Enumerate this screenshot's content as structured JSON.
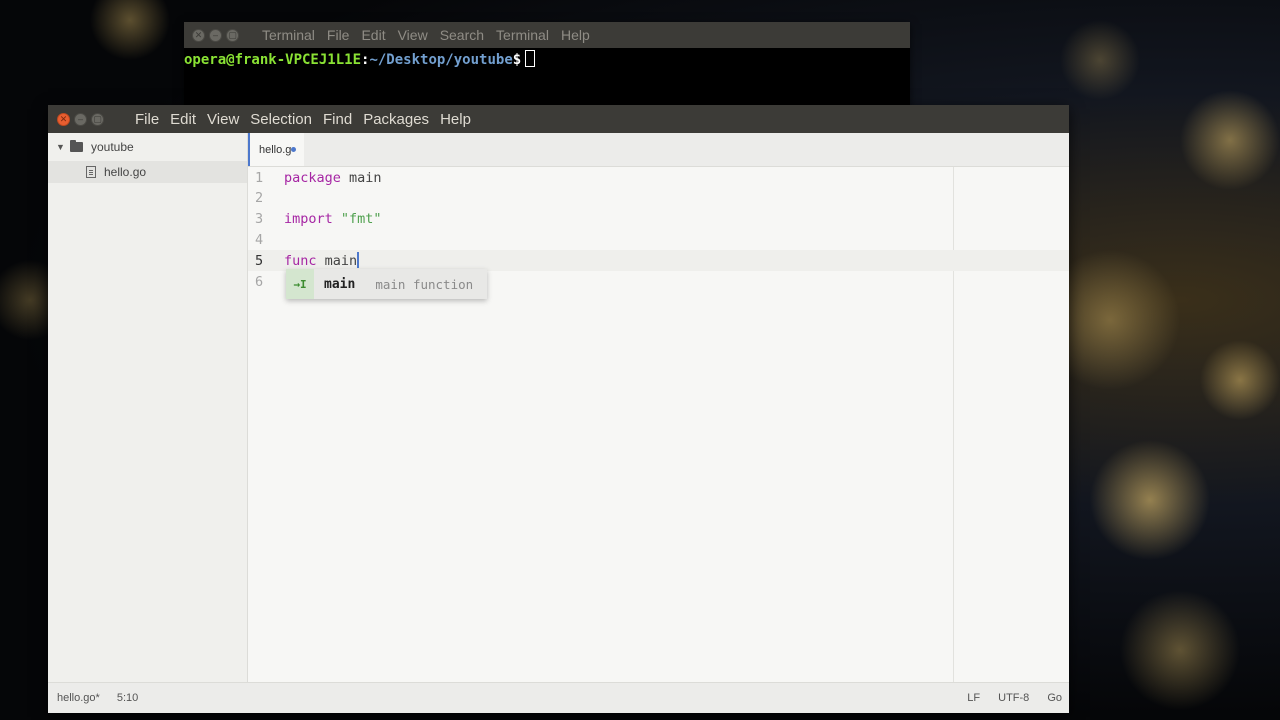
{
  "terminal": {
    "menu": [
      "Terminal",
      "File",
      "Edit",
      "View",
      "Search",
      "Terminal",
      "Help"
    ],
    "prompt_user": "opera@frank-VPCEJ1L1E",
    "prompt_sep": ":",
    "prompt_path": "~/Desktop/youtube",
    "prompt_symbol": "$"
  },
  "atom": {
    "menu": [
      "File",
      "Edit",
      "View",
      "Selection",
      "Find",
      "Packages",
      "Help"
    ],
    "sidebar": {
      "folder": "youtube",
      "files": [
        "hello.go"
      ]
    },
    "tab": {
      "label": "hello.g"
    },
    "code_lines": [
      {
        "num": "1",
        "parts": [
          {
            "t": "package",
            "c": "kw"
          },
          {
            "t": " main",
            "c": ""
          }
        ]
      },
      {
        "num": "2",
        "parts": []
      },
      {
        "num": "3",
        "parts": [
          {
            "t": "import",
            "c": "kw"
          },
          {
            "t": " ",
            "c": ""
          },
          {
            "t": "\"fmt\"",
            "c": "str"
          }
        ]
      },
      {
        "num": "4",
        "parts": []
      },
      {
        "num": "5",
        "parts": [
          {
            "t": "func",
            "c": "kw"
          },
          {
            "t": " main",
            "c": ""
          }
        ]
      },
      {
        "num": "6",
        "parts": []
      }
    ],
    "autocomplete": {
      "icon": "→I",
      "word": "main",
      "description": "main function"
    },
    "status": {
      "file": "hello.go*",
      "cursor": "5:10",
      "line_ending": "LF",
      "encoding": "UTF-8",
      "grammar": "Go"
    },
    "colors": {
      "accent": "#4d78cc",
      "keyword": "#a626a4",
      "string": "#50a14f"
    }
  }
}
